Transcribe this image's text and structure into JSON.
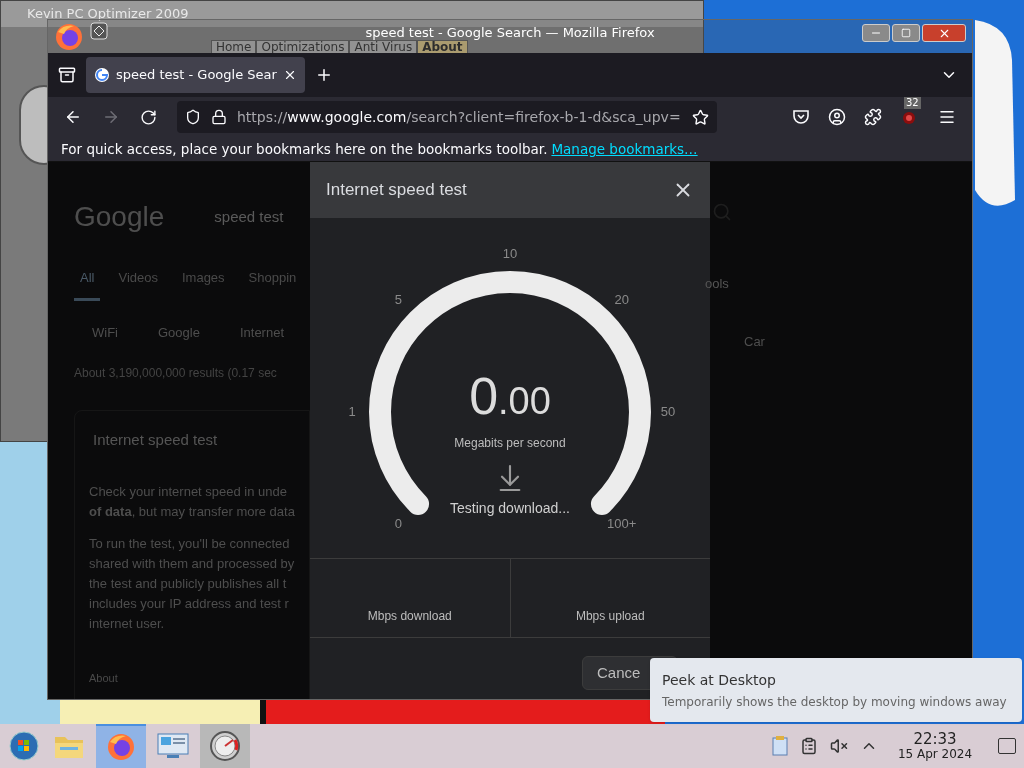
{
  "background_window": {
    "title": "Kevin PC Optimizer 2009",
    "menu": [
      {
        "label": "Home",
        "selected": false
      },
      {
        "label": "Optimizations",
        "selected": false
      },
      {
        "label": "Anti Virus",
        "selected": false
      },
      {
        "label": "About",
        "selected": true
      }
    ]
  },
  "browser": {
    "title": "speed test - Google Search — Mozilla Firefox",
    "tabs": [
      {
        "label": "speed test - Google Sear",
        "selected": true
      }
    ],
    "url": {
      "prefix": "https://",
      "host": "www.google.com",
      "path": "/search?client=firefox-b-1-d&sca_upv="
    },
    "extension_badge": "32",
    "bookmarks_hint": "For quick access, place your bookmarks here on the bookmarks toolbar.",
    "bookmarks_link": "Manage bookmarks…"
  },
  "page": {
    "logo": "Google",
    "query": "speed test",
    "tabs": [
      {
        "label": "All",
        "selected": true
      },
      {
        "label": "Videos",
        "selected": false
      },
      {
        "label": "Images",
        "selected": false
      },
      {
        "label": "Shoppin",
        "selected": false
      }
    ],
    "tools": "ools",
    "chips": [
      "WiFi",
      "Google",
      "Internet"
    ],
    "chip_right": "Car",
    "result_stats": "About 3,190,000,000 results (0.17 sec",
    "card_title": "Internet speed test",
    "paragraph1": [
      "Check your internet speed in unde",
      "**of data**, but may transfer more data"
    ],
    "paragraph2": [
      "To run the test, you'll be connected",
      "shared with them and processed by",
      "the test and publicly publishes all t",
      "includes your IP address and test r",
      "internet user."
    ],
    "about": "About"
  },
  "dialog": {
    "title": "Internet speed test",
    "gauge_ticks": [
      "0",
      "1",
      "5",
      "10",
      "20",
      "50",
      "100+"
    ],
    "value_whole": "0",
    "value_fraction": ".00",
    "unit": "Megabits per second",
    "status": "Testing download...",
    "results": [
      "Mbps download",
      "Mbps upload"
    ],
    "cancel": "Cance"
  },
  "taskbar": {
    "apps": [
      {
        "kind": "folder",
        "selected": false,
        "open": false
      },
      {
        "kind": "firefox",
        "selected": true,
        "open": true
      },
      {
        "kind": "control-panel",
        "selected": false,
        "open": false
      },
      {
        "kind": "gauge",
        "selected": false,
        "open": true
      }
    ],
    "volume_muted": true,
    "time": "22:33",
    "date": "15 Apr 2024"
  },
  "tooltip": {
    "title": "Peek at Desktop",
    "text": "Temporarily shows the desktop by moving windows away"
  }
}
